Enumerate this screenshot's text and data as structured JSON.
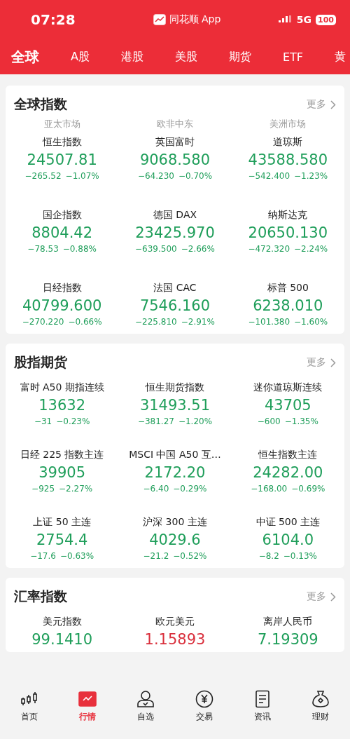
{
  "status_bar": {
    "time": "07:28",
    "app": "同花顺 App",
    "network": "5G",
    "battery": "100"
  },
  "tabs": [
    {
      "label": "全球",
      "selected": true
    },
    {
      "label": "A股",
      "selected": false
    },
    {
      "label": "港股",
      "selected": false
    },
    {
      "label": "美股",
      "selected": false
    },
    {
      "label": "期货",
      "selected": false
    },
    {
      "label": "ETF",
      "selected": false
    },
    {
      "label": "黄",
      "selected": false
    }
  ],
  "sections": [
    {
      "title": "全球指数",
      "more": "更多",
      "columns": [
        "亚太市场",
        "欧非中东",
        "美洲市场"
      ],
      "items": [
        {
          "name": "恒生指数",
          "value": "24507.81",
          "change": "−265.52",
          "percent": "−1.07%",
          "color": "#1f9e5a"
        },
        {
          "name": "英国富时",
          "value": "9068.580",
          "change": "−64.230",
          "percent": "−0.70%",
          "color": "#1f9e5a"
        },
        {
          "name": "道琼斯",
          "value": "43588.580",
          "change": "−542.400",
          "percent": "−1.23%",
          "color": "#1f9e5a"
        },
        {
          "name": "国企指数",
          "value": "8804.42",
          "change": "−78.53",
          "percent": "−0.88%",
          "color": "#1f9e5a"
        },
        {
          "name": "德国 DAX",
          "value": "23425.970",
          "change": "−639.500",
          "percent": "−2.66%",
          "color": "#1f9e5a"
        },
        {
          "name": "纳斯达克",
          "value": "20650.130",
          "change": "−472.320",
          "percent": "−2.24%",
          "color": "#1f9e5a"
        },
        {
          "name": "日经指数",
          "value": "40799.600",
          "change": "−270.220",
          "percent": "−0.66%",
          "color": "#1f9e5a"
        },
        {
          "name": "法国 CAC",
          "value": "7546.160",
          "change": "−225.810",
          "percent": "−2.91%",
          "color": "#1f9e5a"
        },
        {
          "name": "标普 500",
          "value": "6238.010",
          "change": "−101.380",
          "percent": "−1.60%",
          "color": "#1f9e5a"
        }
      ]
    },
    {
      "title": "股指期货",
      "more": "更多",
      "items": [
        {
          "name": "富时 A50 期指连续",
          "value": "13632",
          "change": "−31",
          "percent": "−0.23%",
          "color": "#1f9e5a"
        },
        {
          "name": "恒生期货指数",
          "value": "31493.51",
          "change": "−381.27",
          "percent": "−1.20%",
          "color": "#1f9e5a"
        },
        {
          "name": "迷你道琼斯连续",
          "value": "43705",
          "change": "−600",
          "percent": "−1.35%",
          "color": "#1f9e5a"
        },
        {
          "name": "日经 225 指数主连",
          "value": "39905",
          "change": "−925",
          "percent": "−2.27%",
          "color": "#1f9e5a"
        },
        {
          "name": "MSCI 中国 A50 互…",
          "value": "2172.20",
          "change": "−6.40",
          "percent": "−0.29%",
          "color": "#1f9e5a"
        },
        {
          "name": "恒生指数主连",
          "value": "24282.00",
          "change": "−168.00",
          "percent": "−0.69%",
          "color": "#1f9e5a"
        },
        {
          "name": "上证 50 主连",
          "value": "2754.4",
          "change": "−17.6",
          "percent": "−0.63%",
          "color": "#1f9e5a"
        },
        {
          "name": "沪深 300 主连",
          "value": "4029.6",
          "change": "−21.2",
          "percent": "−0.52%",
          "color": "#1f9e5a"
        },
        {
          "name": "中证 500 主连",
          "value": "6104.0",
          "change": "−8.2",
          "percent": "−0.13%",
          "color": "#1f9e5a"
        }
      ]
    },
    {
      "title": "汇率指数",
      "more": "更多",
      "items": [
        {
          "name": "美元指数",
          "value": "99.1410",
          "color": "#1f9e5a"
        },
        {
          "name": "欧元美元",
          "value": "1.15893",
          "color": "#d92f3c"
        },
        {
          "name": "离岸人民币",
          "value": "7.19309",
          "color": "#1f9e5a"
        }
      ]
    }
  ],
  "nav": [
    {
      "label": "首页",
      "kind": "candles",
      "selected": false
    },
    {
      "label": "行情",
      "kind": "chart",
      "selected": true
    },
    {
      "label": "自选",
      "kind": "person",
      "selected": false
    },
    {
      "label": "交易",
      "kind": "yen",
      "selected": false
    },
    {
      "label": "资讯",
      "kind": "doc",
      "selected": false
    },
    {
      "label": "理财",
      "kind": "bag",
      "selected": false
    }
  ]
}
